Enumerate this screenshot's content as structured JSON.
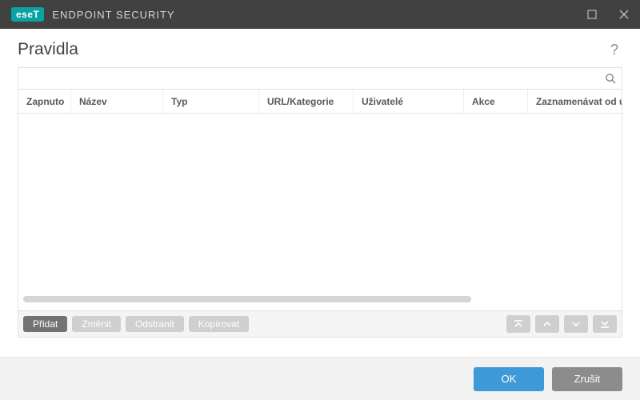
{
  "brand": {
    "badge": "eseT",
    "product": "ENDPOINT SECURITY"
  },
  "page": {
    "title": "Pravidla"
  },
  "search": {
    "value": "",
    "placeholder": ""
  },
  "table": {
    "columns": [
      "Zapnuto",
      "Název",
      "Typ",
      "URL/Kategorie",
      "Uživatelé",
      "Akce",
      "Zaznamenávat od ú"
    ],
    "rows": []
  },
  "panel_actions": {
    "add": "Přidat",
    "edit": "Změnit",
    "delete": "Odstranit",
    "copy": "Kopírovat"
  },
  "footer": {
    "ok": "OK",
    "cancel": "Zrušit"
  }
}
